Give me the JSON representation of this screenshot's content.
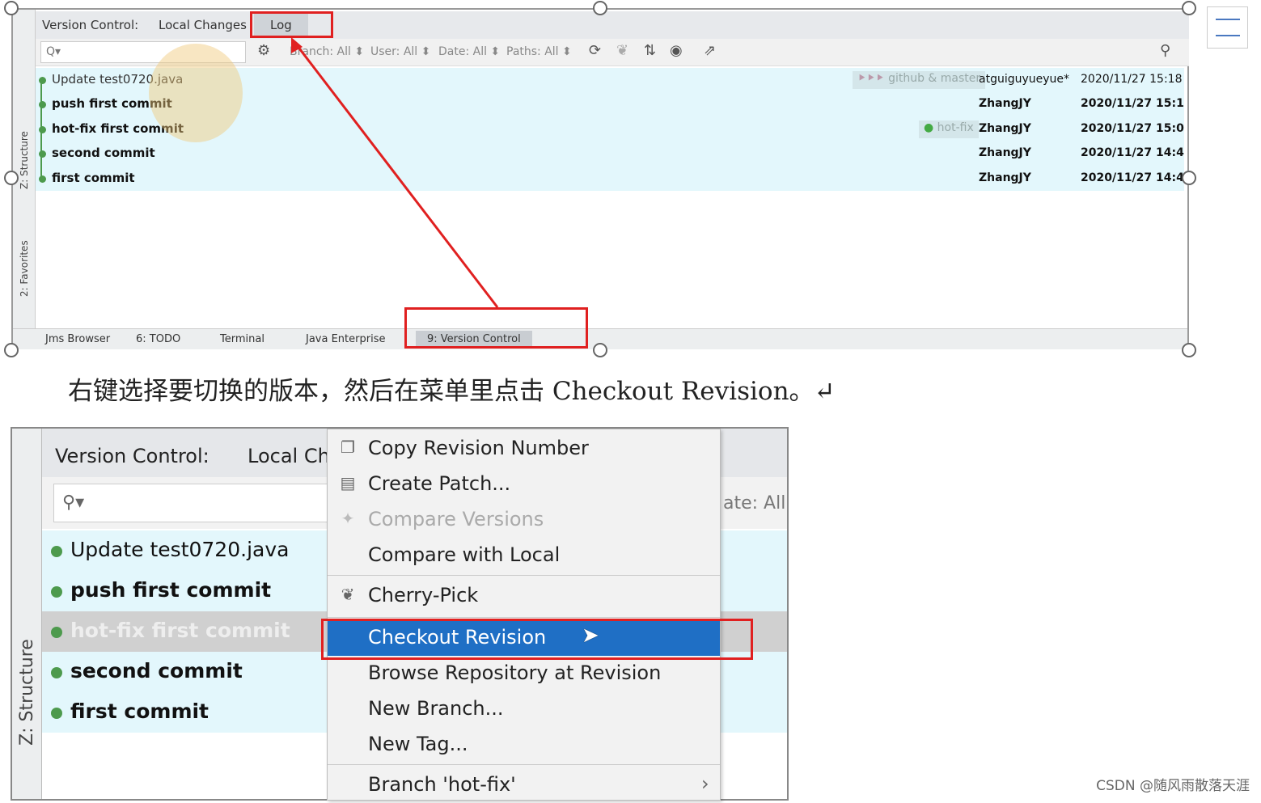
{
  "top_screenshot": {
    "tabs": [
      "Version Control:",
      "Local Changes",
      "Log"
    ],
    "toolbar": {
      "search_placeholder": "Q▾",
      "filters": [
        "Branch: All ⬍",
        "User: All ⬍",
        "Date: All ⬍",
        "Paths: All ⬍"
      ]
    },
    "commits": [
      {
        "message": "Update test0720.java",
        "tag": "github & master",
        "author": "atguiguyueyue*",
        "date": "2020/11/27 15:18"
      },
      {
        "message": "push first commit",
        "tag": "",
        "author": "ZhangJY",
        "date": "2020/11/27 15:1:"
      },
      {
        "message": "hot-fix first commit",
        "tag": "hot-fix",
        "author": "ZhangJY",
        "date": "2020/11/27 15:0:"
      },
      {
        "message": "second commit",
        "tag": "",
        "author": "ZhangJY",
        "date": "2020/11/27 14:4"
      },
      {
        "message": "first commit",
        "tag": "",
        "author": "ZhangJY",
        "date": "2020/11/27 14:4"
      }
    ],
    "side_tabs": [
      "Z: Structure",
      "2: Favorites"
    ],
    "bottom_tabs": [
      "Jms Browser",
      "6: TODO",
      "Terminal",
      "Java Enterprise",
      "9: Version Control"
    ]
  },
  "caption": "右键选择要切换的版本，然后在菜单里点击 Checkout Revision。↵",
  "bottom_screenshot": {
    "header": [
      "Version Control:",
      "Local Ch"
    ],
    "filter_partial": "ate: All",
    "side_tab": "Z: Structure",
    "commits": [
      "Update test0720.java",
      "push first commit",
      "hot-fix first commit",
      "second commit",
      "first commit"
    ],
    "selected_commit": "hot-fix first commit",
    "menu": [
      {
        "label": "Copy Revision Number",
        "icon": "copy-icon"
      },
      {
        "label": "Create Patch...",
        "icon": "patch-icon"
      },
      {
        "label": "Compare Versions",
        "icon": "compare-icon",
        "disabled": true
      },
      {
        "label": "Compare with Local",
        "icon": ""
      },
      {
        "label": "Cherry-Pick",
        "icon": "cherry-icon"
      },
      {
        "label": "Checkout Revision",
        "icon": "",
        "selected": true
      },
      {
        "label": "Browse Repository at Revision",
        "icon": ""
      },
      {
        "label": "New Branch...",
        "icon": ""
      },
      {
        "label": "New Tag...",
        "icon": ""
      },
      {
        "label": "Branch 'hot-fix'",
        "icon": "",
        "submenu": true
      }
    ]
  },
  "watermark": "CSDN @随风雨散落天涯",
  "colors": {
    "highlight": "#e02020",
    "selection": "#1f6fc5",
    "row_bg": "#e3f7fc",
    "graph": "#4d9a4d"
  }
}
